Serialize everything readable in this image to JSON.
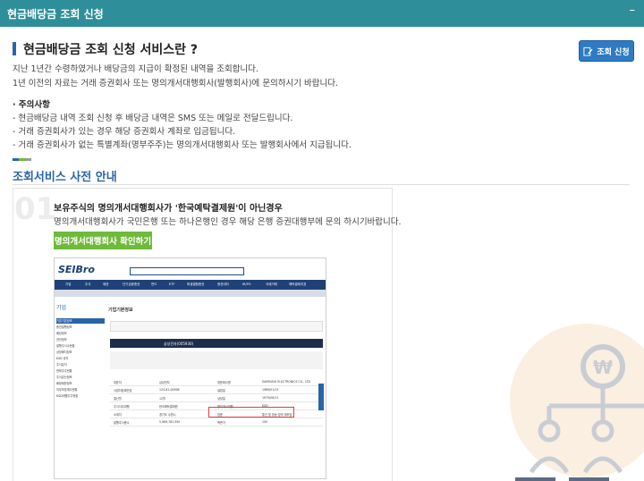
{
  "window": {
    "title": "현금배당금 조회 신청",
    "minimize_glyph": "–"
  },
  "intro": {
    "title": "현금배당금 조회 신청 서비스란 ?",
    "request_button": "조회 신청",
    "lines": [
      "지난 1년간 수령하였거나 배당금의 지급이 확정된 내역을 조회합니다.",
      "1년 이전의 자료는 거래 증권회사 또는 명의개서대행회사(발행회사)에 문의하시기 바랍니다."
    ]
  },
  "notes": {
    "title": "· 주의사항",
    "items": [
      "-  현금배당금 내역 조회 신청 후 배당금 내역은 SMS 또는 메일로 전달드립니다.",
      "-  거래 증권회사가 있는 경우 해당 증권회사 계좌로 입금됩니다.",
      "-  거래 증권회사가 없는 특별계좌(명부주주)는 명의개서대행회사 또는 발행회사에서 지급됩니다."
    ]
  },
  "guide": {
    "title": "조회서비스 사전 안내",
    "accent_colors": [
      "#2a64a8",
      "#6fba3a",
      "#9a9a9a"
    ],
    "step": {
      "number": "01",
      "title": "보유주식의 명의개서대행회사가 '한국예탁결제원'이 아닌경우",
      "desc": "명의개서대행회사가 국민은행 또는 하나은행인 경우 해당 은행 증권대행부에 문의 하시기바랍니다.",
      "button": "명의개서대행회사 확인하기"
    }
  },
  "screenshot": {
    "logo": "SEIBro",
    "nav": [
      "기업",
      "주식",
      "채권",
      "단기금융증권",
      "펀드",
      "ETF",
      "파생결합증권",
      "증권대차",
      "IR/PO",
      "국제거래",
      "예탁결제지표"
    ],
    "left_heading": "기업",
    "left_items": [
      "기업기본정보",
      "증권발행정보",
      "배당정보",
      "권리정보",
      "발행주식수현황",
      "상장폐지정보",
      "KSD 공지",
      "주식분석",
      "현재주주현황",
      "주식분산정보",
      "배정제한정보",
      "의무보호예수현황",
      "KSD대행주주현황"
    ],
    "page_title": "기업기본정보",
    "company": "삼성전자(005930)",
    "grid_rows": [
      [
        "대표자",
        "삼성전자",
        "영문회사명",
        "SAMSUNG ELECTRONICS CO., LTD"
      ],
      [
        "사업자등록번호",
        "124-81-00998",
        "설립일",
        "1969/01/13"
      ],
      [
        "결산월",
        "12월",
        "상장일",
        "1975/06/11"
      ],
      [
        "주식사무대행",
        "한국예탁결제원",
        "명의개서대행",
        "KSD"
      ],
      [
        "소재지",
        "경기도 수원시",
        "업종",
        "통신 및 방송 장비 제조업"
      ],
      [
        "발행주식총수",
        "5,969,782,550",
        "액면가",
        "100"
      ]
    ]
  },
  "colors": {
    "titlebar": "#2e8f9a",
    "accent": "#2a64a8",
    "green": "#6fba3a"
  }
}
